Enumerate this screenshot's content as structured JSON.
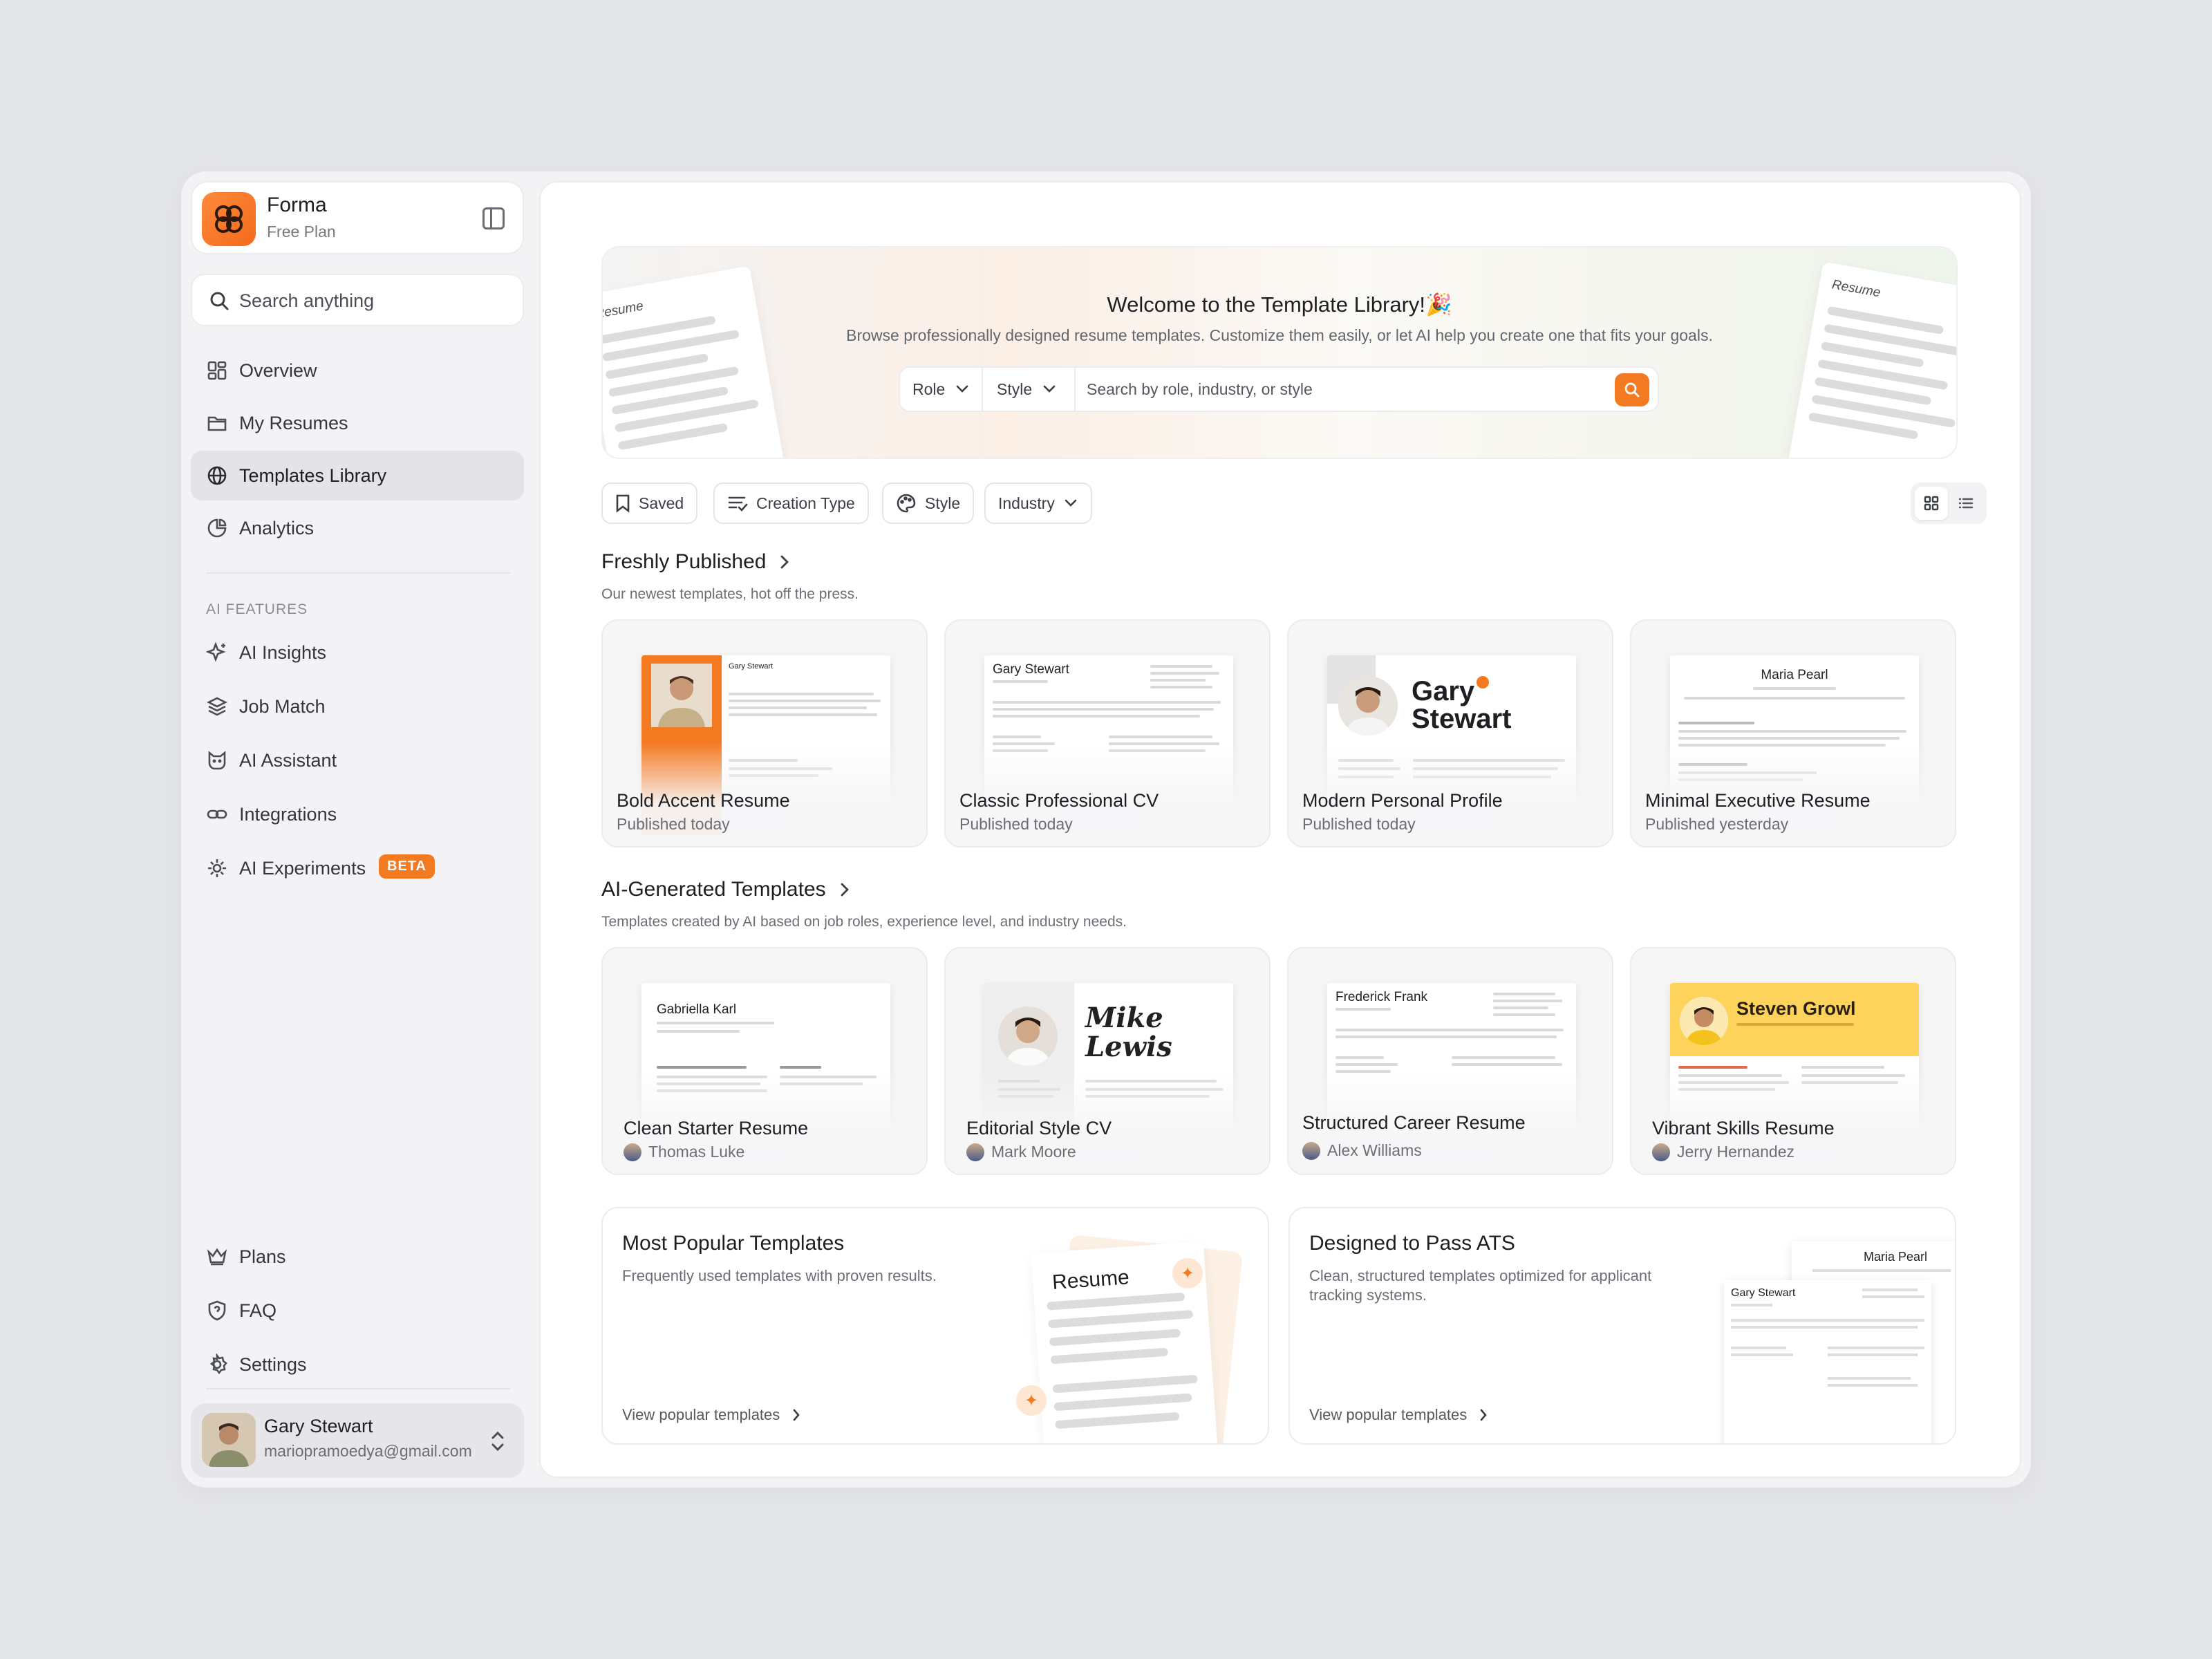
{
  "brand": {
    "name": "Forma",
    "plan": "Free Plan"
  },
  "sidebar": {
    "search_placeholder": "Search anything",
    "nav": [
      {
        "label": "Overview",
        "icon": "grid-icon"
      },
      {
        "label": "My Resumes",
        "icon": "folder-icon"
      },
      {
        "label": "Templates Library",
        "icon": "globe-icon",
        "active": true
      },
      {
        "label": "Analytics",
        "icon": "pie-chart-icon"
      }
    ],
    "ai_section_label": "AI FEATURES",
    "ai_nav": [
      {
        "label": "AI Insights",
        "icon": "sparkles-icon"
      },
      {
        "label": "Job Match",
        "icon": "layers-icon"
      },
      {
        "label": "AI Assistant",
        "icon": "cat-icon"
      },
      {
        "label": "Integrations",
        "icon": "link-icon"
      },
      {
        "label": "AI Experiments",
        "icon": "gear-icon",
        "badge": "BETA"
      }
    ],
    "bottom_nav": [
      {
        "label": "Plans",
        "icon": "crown-icon"
      },
      {
        "label": "FAQ",
        "icon": "shield-icon"
      },
      {
        "label": "Settings",
        "icon": "settings-icon"
      }
    ],
    "user": {
      "name": "Gary Stewart",
      "email": "mariopramoedya@gmail.com"
    }
  },
  "hero": {
    "title": "Welcome to the Template Library!🎉",
    "subtitle": "Browse professionally designed resume templates. Customize them easily, or let AI help you create one that fits your goals.",
    "role_label": "Role",
    "style_label": "Style",
    "search_placeholder": "Search by role, industry, or style",
    "paper_label": "Resume"
  },
  "filters": [
    "Saved",
    "Creation Type",
    "Style",
    "Industry"
  ],
  "freshly": {
    "title": "Freshly Published",
    "subtitle": "Our newest templates, hot off the press.",
    "cards": [
      {
        "title": "Bold Accent Resume",
        "meta": "Published today",
        "name": "Gary Stewart"
      },
      {
        "title": "Classic Professional CV",
        "meta": "Published today",
        "name": "Gary Stewart"
      },
      {
        "title": "Modern Personal Profile",
        "meta": "Published today",
        "name": "Gary Stewart"
      },
      {
        "title": "Minimal Executive Resume",
        "meta": "Published yesterday",
        "name": "Maria Pearl"
      }
    ]
  },
  "ai_generated": {
    "title": "AI-Generated Templates",
    "subtitle": "Templates created by AI based on job roles, experience level, and industry needs.",
    "cards": [
      {
        "title": "Clean Starter Resume",
        "author": "Thomas Luke",
        "name": "Gabriella Karl"
      },
      {
        "title": "Editorial Style CV",
        "author": "Mark Moore",
        "name": "Mike Lewis"
      },
      {
        "title": "Structured Career Resume",
        "author": "Alex Williams",
        "name": "Frederick Frank"
      },
      {
        "title": "Vibrant Skills Resume",
        "author": "Jerry Hernandez",
        "name": "Steven Growl"
      }
    ]
  },
  "promos": [
    {
      "title": "Most Popular Templates",
      "subtitle": "Frequently used templates with proven results.",
      "link": "View popular templates",
      "paper_label": "Resume"
    },
    {
      "title": "Designed to Pass ATS",
      "subtitle": "Clean, structured templates optimized for applicant tracking systems.",
      "link": "View popular templates",
      "doc_names": [
        "Maria Pearl",
        "Gary Stewart"
      ]
    }
  ]
}
